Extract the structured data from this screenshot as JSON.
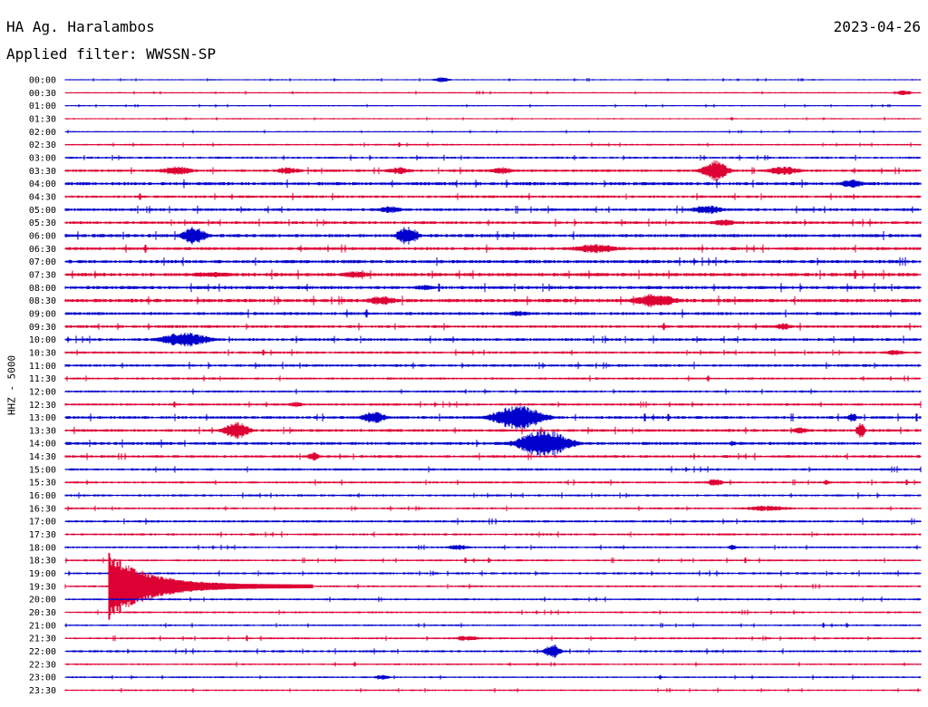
{
  "header": {
    "station": "HA Ag. Haralambos",
    "date": "2023-04-26",
    "filter": "Applied filter: WWSSN-SP"
  },
  "chart_data": {
    "type": "line",
    "title": "HA Ag. Haralambos",
    "ylabel": "HHZ - 5000",
    "trace_colors": [
      "#0000cc",
      "#dd0033"
    ],
    "row_labels": [
      "00:00",
      "00:30",
      "01:00",
      "01:30",
      "02:00",
      "02:30",
      "03:00",
      "03:30",
      "04:00",
      "04:30",
      "05:00",
      "05:30",
      "06:00",
      "06:30",
      "07:00",
      "07:30",
      "08:00",
      "08:30",
      "09:00",
      "09:30",
      "10:00",
      "10:30",
      "11:00",
      "11:30",
      "12:00",
      "12:30",
      "13:00",
      "13:30",
      "14:00",
      "14:30",
      "15:00",
      "15:30",
      "16:00",
      "16:30",
      "17:00",
      "17:30",
      "18:00",
      "18:30",
      "19:00",
      "19:30",
      "20:00",
      "20:30",
      "21:00",
      "21:30",
      "22:00",
      "22:30",
      "23:00",
      "23:30"
    ],
    "noise_level": [
      0.6,
      0.6,
      0.6,
      0.6,
      0.6,
      0.8,
      1.0,
      1.2,
      1.5,
      1.2,
      1.3,
      1.3,
      1.5,
      1.4,
      1.5,
      1.6,
      1.5,
      1.6,
      1.4,
      1.3,
      1.3,
      1.1,
      1.2,
      1.0,
      1.0,
      1.1,
      1.3,
      1.3,
      1.4,
      1.2,
      1.1,
      1.0,
      1.0,
      0.9,
      1.1,
      1.0,
      0.9,
      0.9,
      1.0,
      0.9,
      0.9,
      0.9,
      0.8,
      0.9,
      1.0,
      0.8,
      0.8,
      0.8
    ],
    "events": [
      {
        "row": 0,
        "x": 0.44,
        "amp": 3,
        "dur": 0.02
      },
      {
        "row": 1,
        "x": 0.98,
        "amp": 3,
        "dur": 0.02
      },
      {
        "row": 7,
        "x": 0.13,
        "amp": 5,
        "dur": 0.04
      },
      {
        "row": 7,
        "x": 0.26,
        "amp": 4,
        "dur": 0.03
      },
      {
        "row": 7,
        "x": 0.39,
        "amp": 4,
        "dur": 0.03
      },
      {
        "row": 7,
        "x": 0.51,
        "amp": 4,
        "dur": 0.03
      },
      {
        "row": 7,
        "x": 0.76,
        "amp": 12,
        "dur": 0.03
      },
      {
        "row": 7,
        "x": 0.84,
        "amp": 5,
        "dur": 0.04
      },
      {
        "row": 8,
        "x": 0.92,
        "amp": 5,
        "dur": 0.03
      },
      {
        "row": 10,
        "x": 0.38,
        "amp": 4,
        "dur": 0.03
      },
      {
        "row": 10,
        "x": 0.75,
        "amp": 5,
        "dur": 0.04
      },
      {
        "row": 11,
        "x": 0.77,
        "amp": 4,
        "dur": 0.03
      },
      {
        "row": 12,
        "x": 0.15,
        "amp": 10,
        "dur": 0.03
      },
      {
        "row": 12,
        "x": 0.4,
        "amp": 11,
        "dur": 0.025
      },
      {
        "row": 13,
        "x": 0.62,
        "amp": 5,
        "dur": 0.06
      },
      {
        "row": 15,
        "x": 0.17,
        "amp": 3,
        "dur": 0.06
      },
      {
        "row": 15,
        "x": 0.34,
        "amp": 4,
        "dur": 0.04
      },
      {
        "row": 16,
        "x": 0.42,
        "amp": 3,
        "dur": 0.03
      },
      {
        "row": 17,
        "x": 0.37,
        "amp": 5,
        "dur": 0.04
      },
      {
        "row": 17,
        "x": 0.69,
        "amp": 8,
        "dur": 0.05
      },
      {
        "row": 18,
        "x": 0.53,
        "amp": 3,
        "dur": 0.03
      },
      {
        "row": 19,
        "x": 0.84,
        "amp": 4,
        "dur": 0.02
      },
      {
        "row": 20,
        "x": 0.14,
        "amp": 8,
        "dur": 0.06
      },
      {
        "row": 21,
        "x": 0.97,
        "amp": 3,
        "dur": 0.03
      },
      {
        "row": 25,
        "x": 0.27,
        "amp": 3,
        "dur": 0.02
      },
      {
        "row": 26,
        "x": 0.36,
        "amp": 7,
        "dur": 0.03
      },
      {
        "row": 26,
        "x": 0.53,
        "amp": 14,
        "dur": 0.06
      },
      {
        "row": 26,
        "x": 0.92,
        "amp": 5,
        "dur": 0.01
      },
      {
        "row": 27,
        "x": 0.2,
        "amp": 10,
        "dur": 0.03
      },
      {
        "row": 27,
        "x": 0.86,
        "amp": 4,
        "dur": 0.02
      },
      {
        "row": 27,
        "x": 0.93,
        "amp": 9,
        "dur": 0.01
      },
      {
        "row": 28,
        "x": 0.56,
        "amp": 16,
        "dur": 0.06
      },
      {
        "row": 28,
        "x": 0.78,
        "amp": 3,
        "dur": 0.01
      },
      {
        "row": 29,
        "x": 0.29,
        "amp": 5,
        "dur": 0.015
      },
      {
        "row": 31,
        "x": 0.76,
        "amp": 4,
        "dur": 0.02
      },
      {
        "row": 31,
        "x": 0.89,
        "amp": 3,
        "dur": 0.01
      },
      {
        "row": 33,
        "x": 0.82,
        "amp": 3,
        "dur": 0.06
      },
      {
        "row": 36,
        "x": 0.46,
        "amp": 3,
        "dur": 0.03
      },
      {
        "row": 36,
        "x": 0.78,
        "amp": 3,
        "dur": 0.01
      },
      {
        "row": 39,
        "x": 0.05,
        "amp": 38,
        "dur": 0.24,
        "big": true
      },
      {
        "row": 43,
        "x": 0.47,
        "amp": 3,
        "dur": 0.03
      },
      {
        "row": 44,
        "x": 0.57,
        "amp": 8,
        "dur": 0.02
      },
      {
        "row": 46,
        "x": 0.37,
        "amp": 3,
        "dur": 0.02
      }
    ]
  }
}
